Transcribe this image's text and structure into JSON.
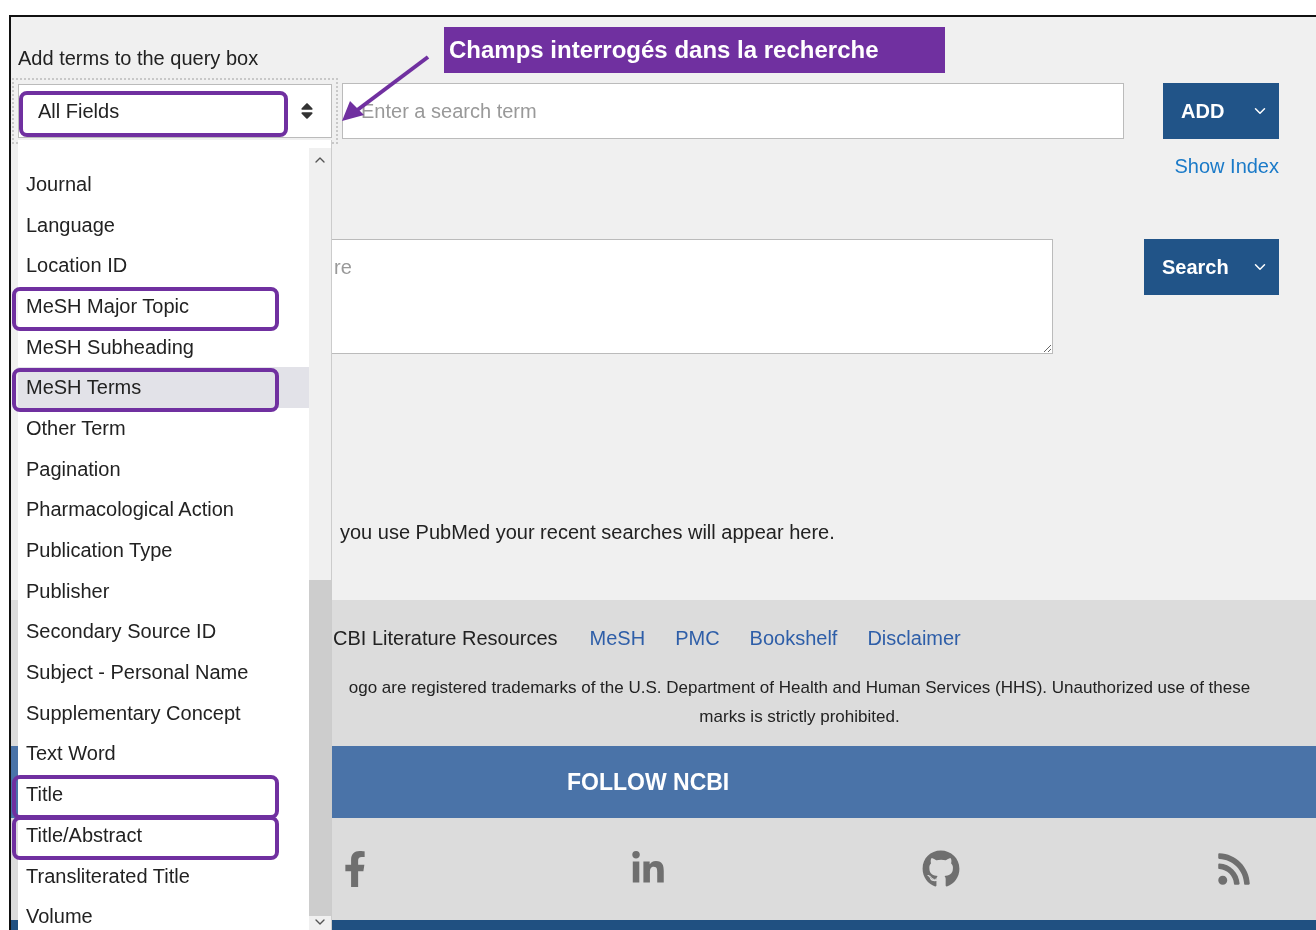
{
  "annotation": {
    "label": "Champs interrogés dans la recherche"
  },
  "query_builder": {
    "label": "Add terms to the query box",
    "field_select": {
      "value": "All Fields",
      "outlined": true
    },
    "term_input": {
      "placeholder": "Enter a search term"
    },
    "add_button": "ADD",
    "show_index_link": "Show Index"
  },
  "query_box": {
    "placeholder": "re",
    "search_button": "Search"
  },
  "history": {
    "empty_message": "you use PubMed your recent searches will appear here."
  },
  "footer": {
    "resources_label": "CBI Literature Resources",
    "links": [
      "MeSH",
      "PMC",
      "Bookshelf",
      "Disclaimer"
    ],
    "trademark_notice": "ogo are registered trademarks of the U.S. Department of Health and Human Services (HHS). Unauthorized use of these marks is strictly prohibited.",
    "follow_heading": "FOLLOW NCBI"
  },
  "field_options": [
    {
      "label": "Journal",
      "selected": false,
      "outlined": false
    },
    {
      "label": "Language",
      "selected": false,
      "outlined": false
    },
    {
      "label": "Location ID",
      "selected": false,
      "outlined": false
    },
    {
      "label": "MeSH Major Topic",
      "selected": false,
      "outlined": true
    },
    {
      "label": "MeSH Subheading",
      "selected": false,
      "outlined": false
    },
    {
      "label": "MeSH Terms",
      "selected": true,
      "outlined": true
    },
    {
      "label": "Other Term",
      "selected": false,
      "outlined": false
    },
    {
      "label": "Pagination",
      "selected": false,
      "outlined": false
    },
    {
      "label": "Pharmacological Action",
      "selected": false,
      "outlined": false
    },
    {
      "label": "Publication Type",
      "selected": false,
      "outlined": false
    },
    {
      "label": "Publisher",
      "selected": false,
      "outlined": false
    },
    {
      "label": "Secondary Source ID",
      "selected": false,
      "outlined": false
    },
    {
      "label": "Subject - Personal Name",
      "selected": false,
      "outlined": false
    },
    {
      "label": "Supplementary Concept",
      "selected": false,
      "outlined": false
    },
    {
      "label": "Text Word",
      "selected": false,
      "outlined": false
    },
    {
      "label": "Title",
      "selected": false,
      "outlined": true
    },
    {
      "label": "Title/Abstract",
      "selected": false,
      "outlined": true
    },
    {
      "label": "Transliterated Title",
      "selected": false,
      "outlined": false
    },
    {
      "label": "Volume",
      "selected": false,
      "outlined": false
    }
  ]
}
